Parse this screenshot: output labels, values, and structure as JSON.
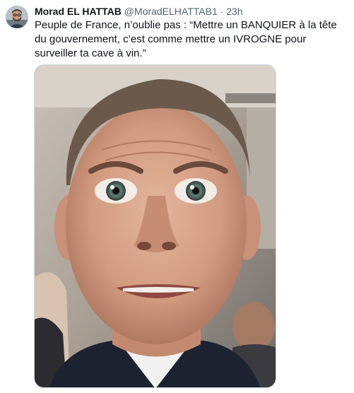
{
  "tweet": {
    "author": {
      "display_name": "Morad EL HATTAB",
      "handle": "@MoradELHATTAB1",
      "separator": "·",
      "time": "23h",
      "avatar_icon": "user-avatar-photo"
    },
    "text": "Peuple de France, n’oublie pas : “Mettre un BANQUIER à la tête du gouvernement, c’est comme mettre un IVROGNE pour surveiller ta cave à vin.”",
    "media": {
      "type": "photo",
      "description_icon": "close-up-face-photo"
    }
  },
  "colors": {
    "text_primary": "#0f1419",
    "text_secondary": "#536471",
    "border": "#cfd9de",
    "background": "#ffffff"
  }
}
